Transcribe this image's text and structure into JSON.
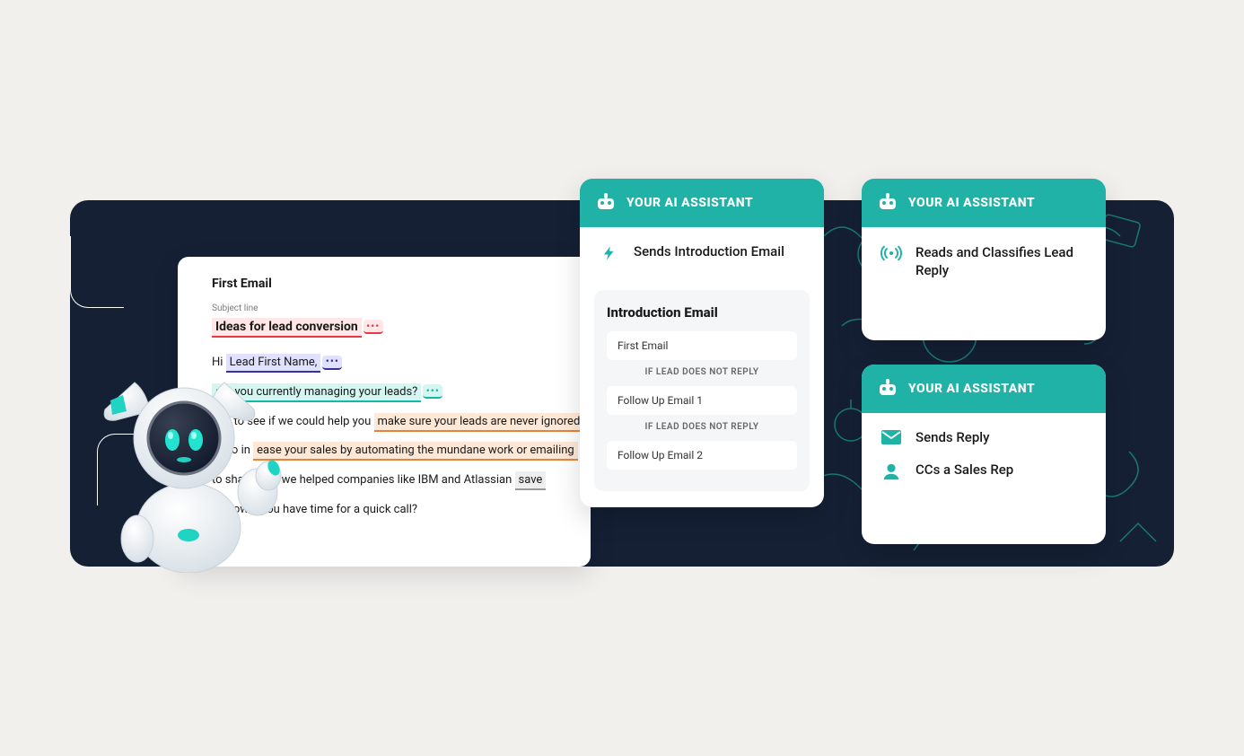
{
  "email": {
    "title": "First Email",
    "subject_label": "Subject line",
    "subject": "Ideas for lead conversion",
    "body": {
      "greeting_prefix": "Hi",
      "greeting_token": "Lead First Name,",
      "line2_text": "are you currently managing your leads?",
      "line3_prefix": "ous to see if we could help you",
      "line3_token": "make sure your leads are never ignored",
      "line4_prefix": "ou to in",
      "line4_text": "ease your sales by automating the mundane work or emailing",
      "line5_prefix": "to share how we helped companies like IBM and Atlassian",
      "line5_token": "save",
      "line6": "e know if you have time for a quick call?"
    }
  },
  "assistant_header": "YOUR AI ASSISTANT",
  "card1": {
    "action": "Sends Introduction Email",
    "seq": {
      "title": "Introduction Email",
      "step1": "First Email",
      "cond": "IF LEAD DOES NOT REPLY",
      "step2": "Follow Up Email 1",
      "step3": "Follow Up Email 2"
    }
  },
  "card2": {
    "action": "Reads and Classifies Lead Reply"
  },
  "card3": {
    "action1": "Sends Reply",
    "action2": "CCs a Sales Rep"
  },
  "colors": {
    "teal": "#20b2a6",
    "dark": "#152035"
  }
}
